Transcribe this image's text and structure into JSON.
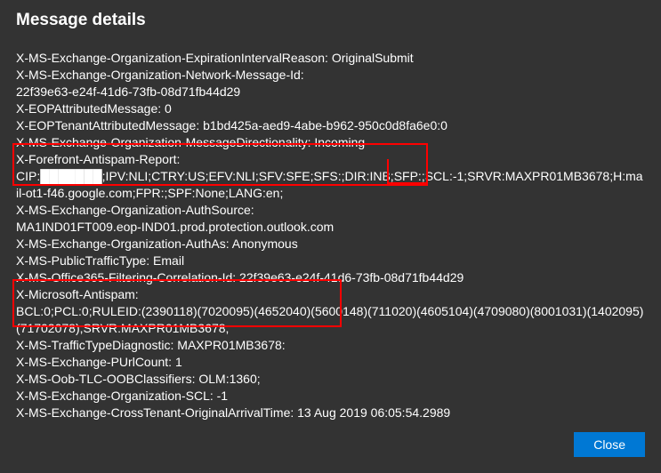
{
  "title": "Message details",
  "headers": [
    "X-MS-Exchange-Organization-ExpirationIntervalReason: OriginalSubmit",
    "X-MS-Exchange-Organization-Network-Message-Id:",
    "22f39e63-e24f-41d6-73fb-08d71fb44d29",
    "X-EOPAttributedMessage: 0",
    "X-EOPTenantAttributedMessage: b1bd425a-aed9-4abe-b962-950c0d8fa6e0:0",
    "X-MS-Exchange-Organization-MessageDirectionality: Incoming",
    "X-Forefront-Antispam-Report:",
    "CIP:███████;IPV:NLI;CTRY:US;EFV:NLI;SFV:SFE;SFS:;DIR:INB;SFP:;SCL:-1;SRVR:MAXPR01MB3678;H:mail-ot1-f46.google.com;FPR:;SPF:None;LANG:en;",
    "X-MS-Exchange-Organization-AuthSource:",
    "MA1IND01FT009.eop-IND01.prod.protection.outlook.com",
    "X-MS-Exchange-Organization-AuthAs: Anonymous",
    "X-MS-PublicTrafficType: Email",
    "X-MS-Office365-Filtering-Correlation-Id: 22f39e63-e24f-41d6-73fb-08d71fb44d29",
    "X-Microsoft-Antispam:",
    "BCL:0;PCL:0;RULEID:(2390118)(7020095)(4652040)(5600148)(711020)(4605104)(4709080)(8001031)(1402095)(71702078);SRVR:MAXPR01MB3678;",
    "X-MS-TrafficTypeDiagnostic: MAXPR01MB3678:",
    "X-MS-Exchange-PUrlCount: 1",
    "X-MS-Oob-TLC-OOBClassifiers: OLM:1360;",
    "X-MS-Exchange-Organization-SCL: -1",
    "X-MS-Exchange-CrossTenant-OriginalArrivalTime: 13 Aug 2019 06:05:54.2989"
  ],
  "buttons": {
    "close": "Close"
  },
  "highlight_color": "#ff0000"
}
